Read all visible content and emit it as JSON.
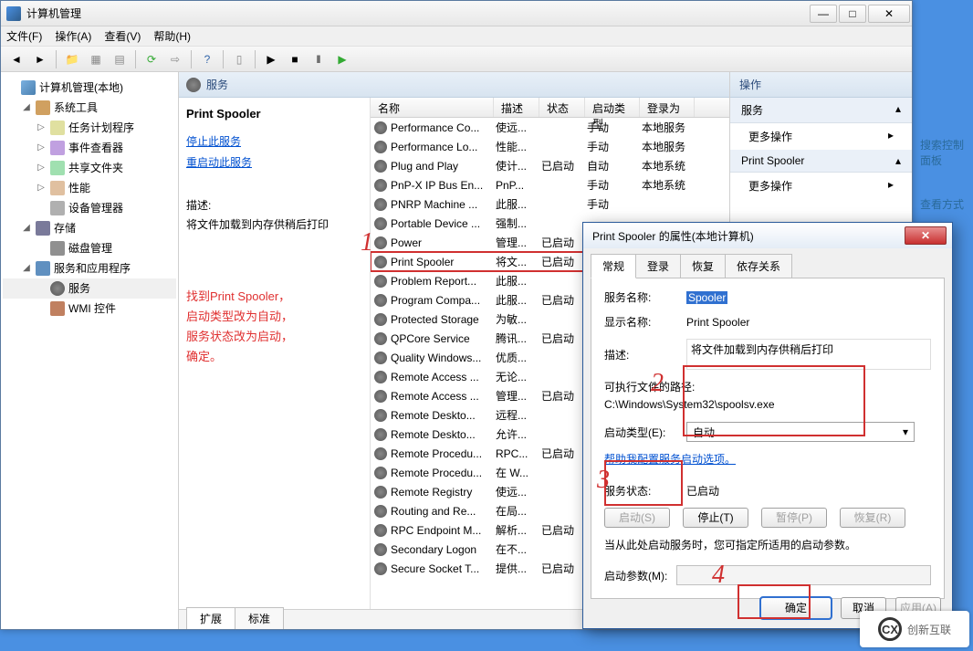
{
  "window": {
    "title": "计算机管理"
  },
  "menus": [
    "文件(F)",
    "操作(A)",
    "查看(V)",
    "帮助(H)"
  ],
  "tree": [
    {
      "label": "计算机管理(本地)",
      "level": 1,
      "icon": "ic-computer",
      "tw": ""
    },
    {
      "label": "系统工具",
      "level": 2,
      "icon": "ic-tools",
      "tw": "◢"
    },
    {
      "label": "任务计划程序",
      "level": 3,
      "icon": "ic-task",
      "tw": "▷"
    },
    {
      "label": "事件查看器",
      "level": 3,
      "icon": "ic-event",
      "tw": "▷"
    },
    {
      "label": "共享文件夹",
      "level": 3,
      "icon": "ic-share",
      "tw": "▷"
    },
    {
      "label": "性能",
      "level": 3,
      "icon": "ic-perf",
      "tw": "▷"
    },
    {
      "label": "设备管理器",
      "level": 3,
      "icon": "ic-device",
      "tw": ""
    },
    {
      "label": "存储",
      "level": 2,
      "icon": "ic-storage",
      "tw": "◢"
    },
    {
      "label": "磁盘管理",
      "level": 3,
      "icon": "ic-disk",
      "tw": ""
    },
    {
      "label": "服务和应用程序",
      "level": 2,
      "icon": "ic-services-app",
      "tw": "◢"
    },
    {
      "label": "服务",
      "level": 3,
      "icon": "ic-gear",
      "tw": "",
      "sel": true
    },
    {
      "label": "WMI 控件",
      "level": 3,
      "icon": "ic-wmi",
      "tw": ""
    }
  ],
  "mid_head": "服务",
  "detail": {
    "title": "Print Spooler",
    "stop_link": "停止此服务",
    "restart_link": "重启动此服务",
    "desc_label": "描述:",
    "desc_text": "将文件加载到内存供稍后打印"
  },
  "annotation": "找到Print Spooler，\n启动类型改为自动，\n服务状态改为启动，\n确定。",
  "columns": {
    "name": "名称",
    "desc": "描述",
    "state": "状态",
    "start": "启动类型",
    "logon": "登录为"
  },
  "rows": [
    {
      "name": "Performance Co...",
      "desc": "使远...",
      "state": "",
      "start": "手动",
      "logon": "本地服务"
    },
    {
      "name": "Performance Lo...",
      "desc": "性能...",
      "state": "",
      "start": "手动",
      "logon": "本地服务"
    },
    {
      "name": "Plug and Play",
      "desc": "使计...",
      "state": "已启动",
      "start": "自动",
      "logon": "本地系统"
    },
    {
      "name": "PnP-X IP Bus En...",
      "desc": "PnP...",
      "state": "",
      "start": "手动",
      "logon": "本地系统"
    },
    {
      "name": "PNRP Machine ...",
      "desc": "此服...",
      "state": "",
      "start": "手动",
      "logon": ""
    },
    {
      "name": "Portable Device ...",
      "desc": "强制...",
      "state": "",
      "start": "",
      "logon": ""
    },
    {
      "name": "Power",
      "desc": "管理...",
      "state": "已启动",
      "start": "",
      "logon": ""
    },
    {
      "name": "Print Spooler",
      "desc": "将文...",
      "state": "已启动",
      "start": "",
      "logon": "",
      "hl": true
    },
    {
      "name": "Problem Report...",
      "desc": "此服...",
      "state": "",
      "start": "",
      "logon": ""
    },
    {
      "name": "Program Compa...",
      "desc": "此服...",
      "state": "已启动",
      "start": "",
      "logon": ""
    },
    {
      "name": "Protected Storage",
      "desc": "为敏...",
      "state": "",
      "start": "",
      "logon": ""
    },
    {
      "name": "QPCore Service",
      "desc": "腾讯...",
      "state": "已启动",
      "start": "",
      "logon": ""
    },
    {
      "name": "Quality Windows...",
      "desc": "优质...",
      "state": "",
      "start": "",
      "logon": ""
    },
    {
      "name": "Remote Access ...",
      "desc": "无论...",
      "state": "",
      "start": "",
      "logon": ""
    },
    {
      "name": "Remote Access ...",
      "desc": "管理...",
      "state": "已启动",
      "start": "",
      "logon": ""
    },
    {
      "name": "Remote Deskto...",
      "desc": "远程...",
      "state": "",
      "start": "",
      "logon": ""
    },
    {
      "name": "Remote Deskto...",
      "desc": "允许...",
      "state": "",
      "start": "",
      "logon": ""
    },
    {
      "name": "Remote Procedu...",
      "desc": "RPC...",
      "state": "已启动",
      "start": "",
      "logon": ""
    },
    {
      "name": "Remote Procedu...",
      "desc": "在 W...",
      "state": "",
      "start": "",
      "logon": ""
    },
    {
      "name": "Remote Registry",
      "desc": "使远...",
      "state": "",
      "start": "",
      "logon": ""
    },
    {
      "name": "Routing and Re...",
      "desc": "在局...",
      "state": "",
      "start": "",
      "logon": ""
    },
    {
      "name": "RPC Endpoint M...",
      "desc": "解析...",
      "state": "已启动",
      "start": "",
      "logon": ""
    },
    {
      "name": "Secondary Logon",
      "desc": "在不...",
      "state": "",
      "start": "",
      "logon": ""
    },
    {
      "name": "Secure Socket T...",
      "desc": "提供...",
      "state": "已启动",
      "start": "",
      "logon": ""
    }
  ],
  "mid_tabs": {
    "ext": "扩展",
    "std": "标准"
  },
  "actions": {
    "head": "操作",
    "sec1": "服务",
    "item1": "更多操作",
    "sec2": "Print Spooler",
    "item2": "更多操作"
  },
  "dialog": {
    "title": "Print Spooler 的属性(本地计算机)",
    "tabs": [
      "常规",
      "登录",
      "恢复",
      "依存关系"
    ],
    "svc_name_lbl": "服务名称:",
    "svc_name_val": "Spooler",
    "disp_name_lbl": "显示名称:",
    "disp_name_val": "Print Spooler",
    "desc_lbl": "描述:",
    "desc_val": "将文件加载到内存供稍后打印",
    "exe_lbl": "可执行文件的路径:",
    "exe_val": "C:\\Windows\\System32\\spoolsv.exe",
    "start_type_lbl": "启动类型(E):",
    "start_type_val": "自动",
    "help_link": "帮助我配置服务启动选项。",
    "svc_state_lbl": "服务状态:",
    "svc_state_val": "已启动",
    "btn_start": "启动(S)",
    "btn_stop": "停止(T)",
    "btn_pause": "暂停(P)",
    "btn_resume": "恢复(R)",
    "hint": "当从此处启动服务时，您可指定所适用的启动参数。",
    "start_param_lbl": "启动参数(M):",
    "ok": "确定",
    "cancel": "取消",
    "apply": "应用(A)"
  },
  "peek1": "搜索控制面板",
  "peek2": "查看方式",
  "logo_text": "创新互联"
}
